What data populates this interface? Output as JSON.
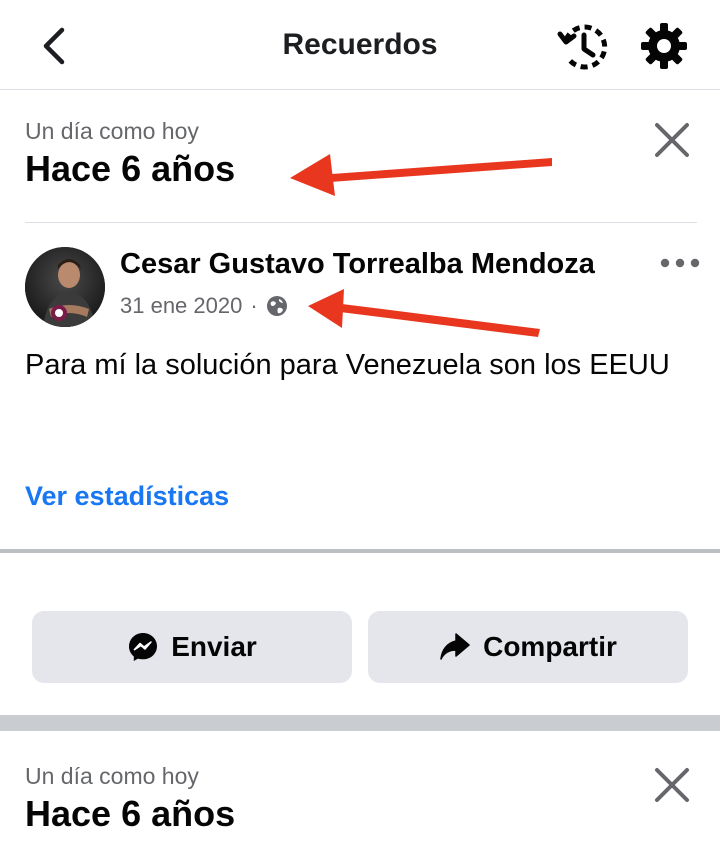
{
  "header": {
    "title": "Recuerdos"
  },
  "memories": [
    {
      "eyebrow": "Un día como hoy",
      "title": "Hace 6 años"
    },
    {
      "eyebrow": "Un día como hoy",
      "title": "Hace 6 años"
    }
  ],
  "post": {
    "author": "Cesar Gustavo Torrealba Mendoza",
    "date": "31 ene 2020",
    "separator": "·",
    "privacy_icon": "globe-icon",
    "text": "Para mí la solución para Venezuela son los EEUU",
    "stats_link": "Ver estadísticas"
  },
  "actions": {
    "send_label": "Enviar",
    "share_label": "Compartir"
  },
  "colors": {
    "link": "#1877f2",
    "button_bg": "#e4e6eb",
    "annotation_arrow": "#e8361f"
  }
}
